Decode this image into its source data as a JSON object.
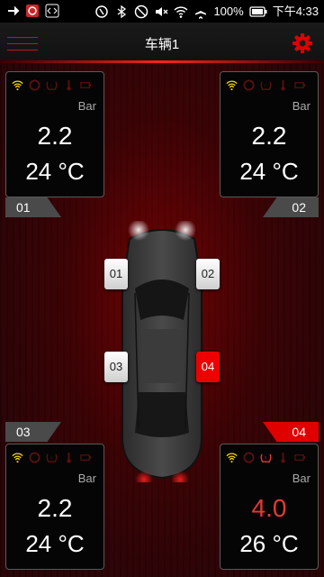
{
  "status_bar": {
    "battery": "100%",
    "time": "下午4:33"
  },
  "app_bar": {
    "title": "车辆1"
  },
  "colors": {
    "accent": "#e00000",
    "alert_text": "#e53935",
    "wifi_icon": "#f5d800"
  },
  "tires": [
    {
      "id": "front-left",
      "position_label": "01",
      "unit": "Bar",
      "pressure": "2.2",
      "temperature": "24 °C",
      "alert": false
    },
    {
      "id": "front-right",
      "position_label": "02",
      "unit": "Bar",
      "pressure": "2.2",
      "temperature": "24 °C",
      "alert": false
    },
    {
      "id": "rear-left",
      "position_label": "03",
      "unit": "Bar",
      "pressure": "2.2",
      "temperature": "24 °C",
      "alert": false
    },
    {
      "id": "rear-right",
      "position_label": "04",
      "unit": "Bar",
      "pressure": "4.0",
      "temperature": "26 °C",
      "alert": true
    }
  ],
  "card_icons": [
    "signal-icon",
    "tire-warning-icon",
    "pressure-icon",
    "thermometer-icon",
    "battery-icon"
  ],
  "wheel_buttons": [
    "01",
    "02",
    "03",
    "04"
  ]
}
